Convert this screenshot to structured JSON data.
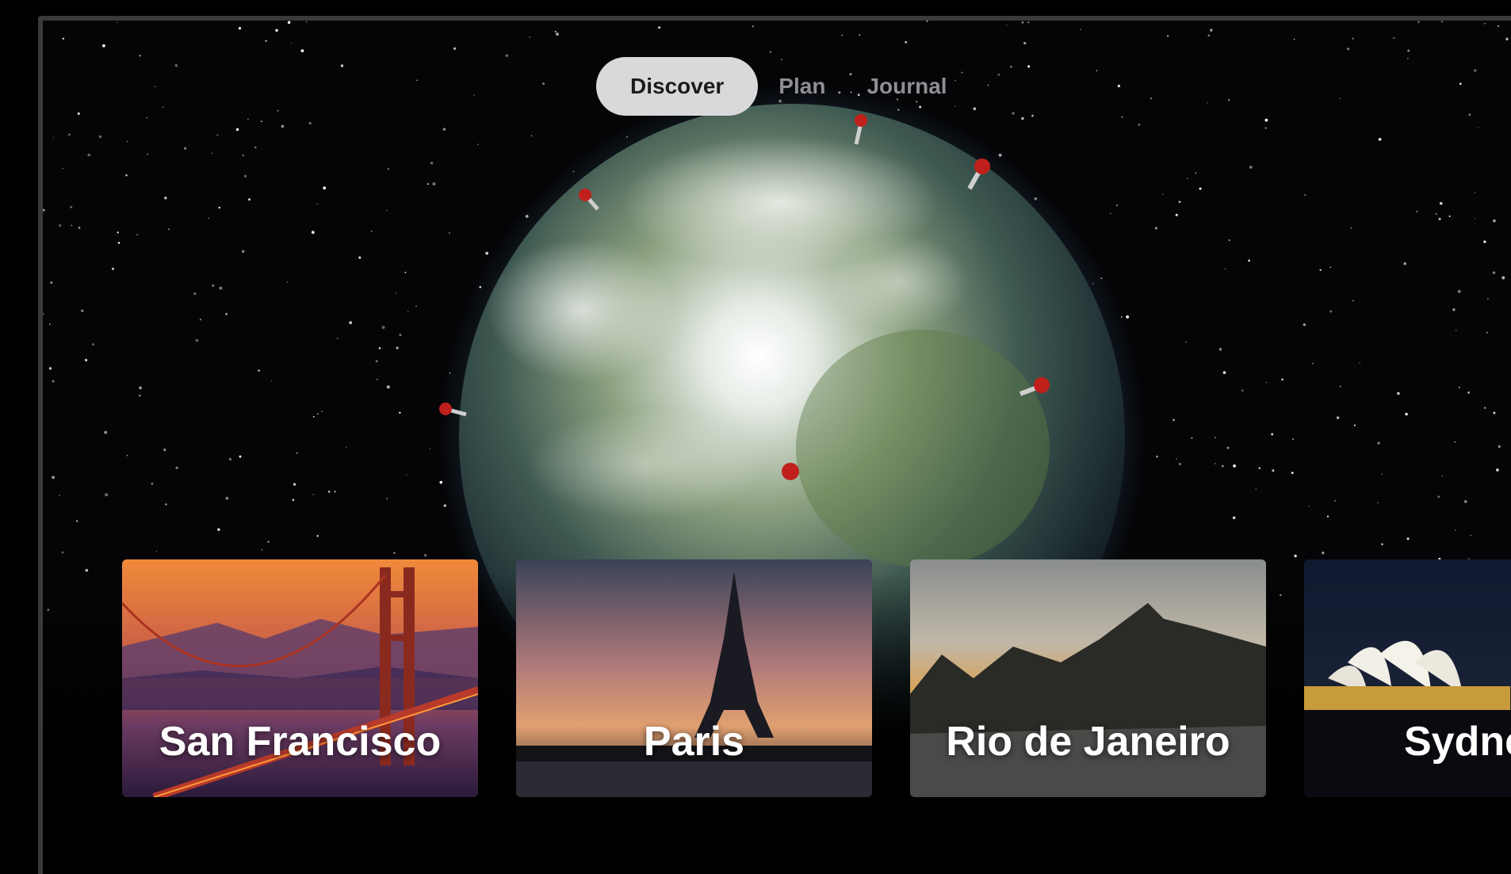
{
  "tabs": [
    {
      "label": "Discover",
      "active": true
    },
    {
      "label": "Plan",
      "active": false
    },
    {
      "label": "Journal",
      "active": false
    }
  ],
  "globe": {
    "pins": [
      "pin-north-1",
      "pin-north-2",
      "pin-west",
      "pin-east",
      "pin-left",
      "pin-coast"
    ]
  },
  "destinations": [
    {
      "name": "San Francisco",
      "icon": "golden-gate-bridge"
    },
    {
      "name": "Paris",
      "icon": "eiffel-tower"
    },
    {
      "name": "Rio de Janeiro",
      "icon": "sugarloaf-mountain"
    },
    {
      "name": "Sydney",
      "icon": "opera-house"
    }
  ],
  "colors": {
    "accent_pin": "#c0201b",
    "tab_active_bg": "#d9d9dc",
    "tab_text": "#8e8e93"
  }
}
